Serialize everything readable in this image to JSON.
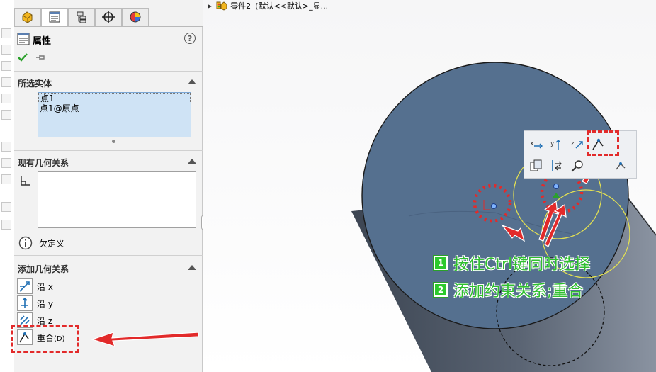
{
  "feature_tree": {
    "part_label": "零件2",
    "config_label": "(默认<<默认>_显..."
  },
  "tabs": [
    "feature-manager",
    "property-manager",
    "configuration-manager",
    "dimxpert-manager",
    "display-manager"
  ],
  "property_manager": {
    "title": "属性",
    "help_label": "?",
    "sections": {
      "selected": {
        "title": "所选实体",
        "items": [
          "点1",
          "点1@原点"
        ]
      },
      "existing": {
        "title": "现有几何关系",
        "status": "欠定义"
      },
      "add": {
        "title": "添加几何关系",
        "items": [
          {
            "label": "沿",
            "underline": "x",
            "icon": "along-x-icon"
          },
          {
            "label": "沿",
            "underline": "y",
            "icon": "along-y-icon"
          },
          {
            "label": "沿",
            "underline": "z",
            "icon": "along-z-icon"
          },
          {
            "label": "重合",
            "underline": "(D)",
            "icon": "coincident-icon"
          }
        ]
      }
    }
  },
  "context_toolbar": {
    "row1": [
      "x",
      "y",
      "z"
    ],
    "row2": []
  },
  "annotations": [
    {
      "num": "1",
      "text": "按住Ctrl键同时选择"
    },
    {
      "num": "2",
      "text": "添加约束关系;重合"
    }
  ],
  "colors": {
    "accent_green": "#2fbf2f",
    "annotation_red": "#e22a2a",
    "cylinder_face": "#55708f",
    "selection_blue": "#cfe3f5"
  }
}
